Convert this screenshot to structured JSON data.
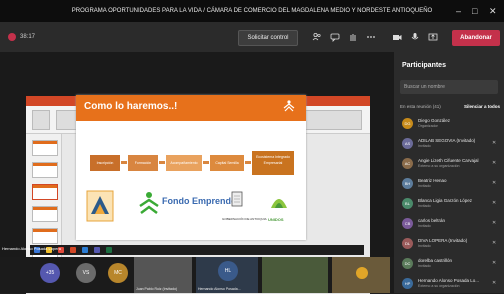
{
  "window": {
    "title": "PROGRAMA OPORTUNIDADES PARA LA VIDA / CÁMARA DE COMERCIO DEL MAGDALENA MEDIO Y NORDESTE ANTIOQUEÑO",
    "minimize_glyph": "–",
    "maximize_glyph": "□",
    "close_glyph": "✕"
  },
  "meeting_bar": {
    "timer": "38:17",
    "request_control": "Solicitar control",
    "leave": "Abandonar",
    "icons": [
      "people-icon",
      "chat-icon",
      "hand-icon",
      "more-icon",
      "camera-icon",
      "mic-icon",
      "share-icon"
    ]
  },
  "presentation": {
    "slide_title": "Como lo haremos..!",
    "steps": [
      "Inscripción",
      "Formación",
      "Acompañamiento",
      "Capital Semilla",
      "Ecosistema Integrado Empresarial"
    ],
    "logos": [
      "SENA",
      "Fondo Emprender",
      "GOBERNACIÓN DE ANTIOQUIA",
      "UNIDOS"
    ],
    "notes_label": "Haga clic para agregar notas"
  },
  "sidebar": {
    "title": "Participantes",
    "search_placeholder": "Buscar un nombre",
    "in_call_label": "En esta reunión (41)",
    "mute_all": "Silenciar a todos",
    "participants": [
      {
        "initials": "DG",
        "name": "Diego González",
        "role": "Organizador",
        "color": "#c68a1a"
      },
      {
        "initials": "AS",
        "name": "ADILAB SEGOVIA (Invitado)",
        "role": "Invitado",
        "color": "#6b6b99"
      },
      {
        "initials": "AC",
        "name": "Angie Lizeth Cifuente Carvajal",
        "role": "Externo a su organización",
        "color": "#8a6b4a"
      },
      {
        "initials": "BH",
        "name": "Beatriz Henao",
        "role": "Invitado",
        "color": "#5c7c9c"
      },
      {
        "initials": "BL",
        "name": "Blanca Ligia Garzón López",
        "role": "Invitado",
        "color": "#4a8a6a"
      },
      {
        "initials": "CB",
        "name": "carlos beltrán",
        "role": "Invitado",
        "color": "#7a5a9a"
      },
      {
        "initials": "DL",
        "name": "DIVA LOPERA (Invitado)",
        "role": "Invitado",
        "color": "#9a5a5a"
      },
      {
        "initials": "DC",
        "name": "dorelba castrillón",
        "role": "Invitado",
        "color": "#5a7a5a"
      },
      {
        "initials": "HP",
        "name": "Hernando Alonso Posada Lo...",
        "role": "Externo a su organización",
        "color": "#3a6a9a"
      }
    ]
  },
  "gallery": {
    "speaker_label": "Hernando Alonso Posada Lopera",
    "chips": [
      {
        "label": "+35",
        "color": "#5558af"
      },
      {
        "label": "VS",
        "color": "#6b6b6b"
      },
      {
        "label": "MC",
        "color": "#b8862b"
      },
      {
        "label": "HL",
        "color": "#3a5a8a"
      }
    ],
    "tiles": [
      "Juan Pablo Ruiz (Invitado)",
      "Hernando Alonso Posada...",
      "",
      ""
    ]
  }
}
